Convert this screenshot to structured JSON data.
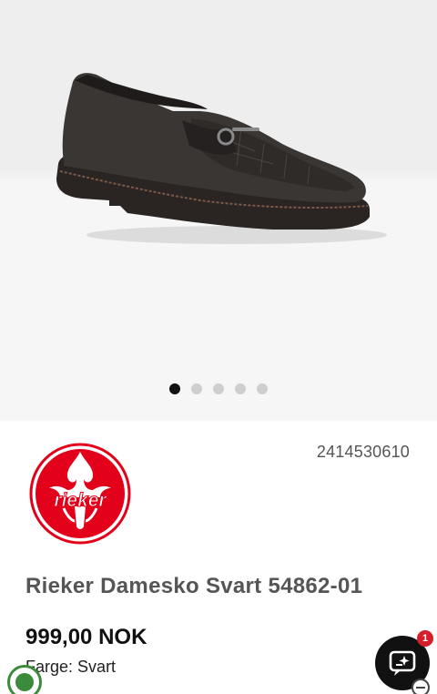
{
  "gallery": {
    "image_alt": "Rieker Damesko Svart 54862-01",
    "dot_count": 5,
    "active_dot": 0
  },
  "product": {
    "sku": "2414530610",
    "brand_logo_text": "rieker",
    "title": "Rieker Damesko Svart 54862-01",
    "price": "999,00 NOK",
    "color_label": "Farge:",
    "color_value": "Svart"
  },
  "chat": {
    "icon": "chat-sparkle-icon",
    "unread_count": "1"
  },
  "colors": {
    "brand_red": "#e2001a",
    "active_dot": "#111111",
    "inactive_dot": "#cfcfcf",
    "badge_red": "#d51f2c",
    "eco_green": "#3c8a3c"
  }
}
